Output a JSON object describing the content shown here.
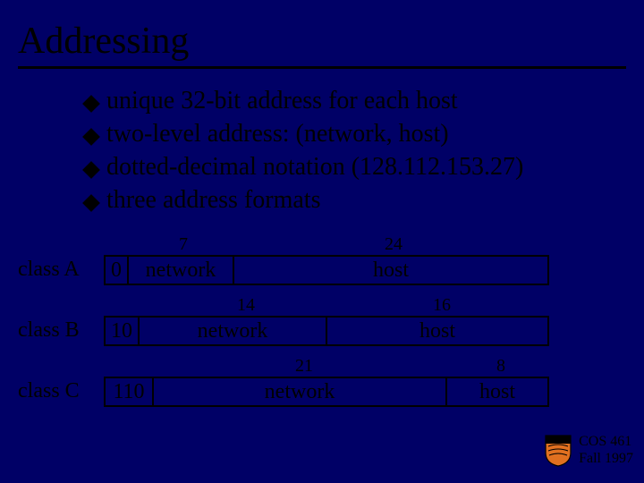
{
  "title": "Addressing",
  "bullets": [
    "unique 32-bit address for each host",
    "two-level address: (network, host)",
    "dotted-decimal notation (128.112.153.27)",
    "three address formats"
  ],
  "classes": {
    "a": {
      "label": "class A",
      "prefix": "0",
      "net_label": "network",
      "host_label": "host",
      "net_bits": "7",
      "host_bits": "24"
    },
    "b": {
      "label": "class B",
      "prefix": "10",
      "net_label": "network",
      "host_label": "host",
      "net_bits": "14",
      "host_bits": "16"
    },
    "c": {
      "label": "class C",
      "prefix": "110",
      "net_label": "network",
      "host_label": "host",
      "net_bits": "21",
      "host_bits": "8"
    }
  },
  "footer": {
    "course": "COS 461",
    "term": "Fall 1997"
  },
  "colors": {
    "background": "#000066",
    "text": "#000000"
  }
}
